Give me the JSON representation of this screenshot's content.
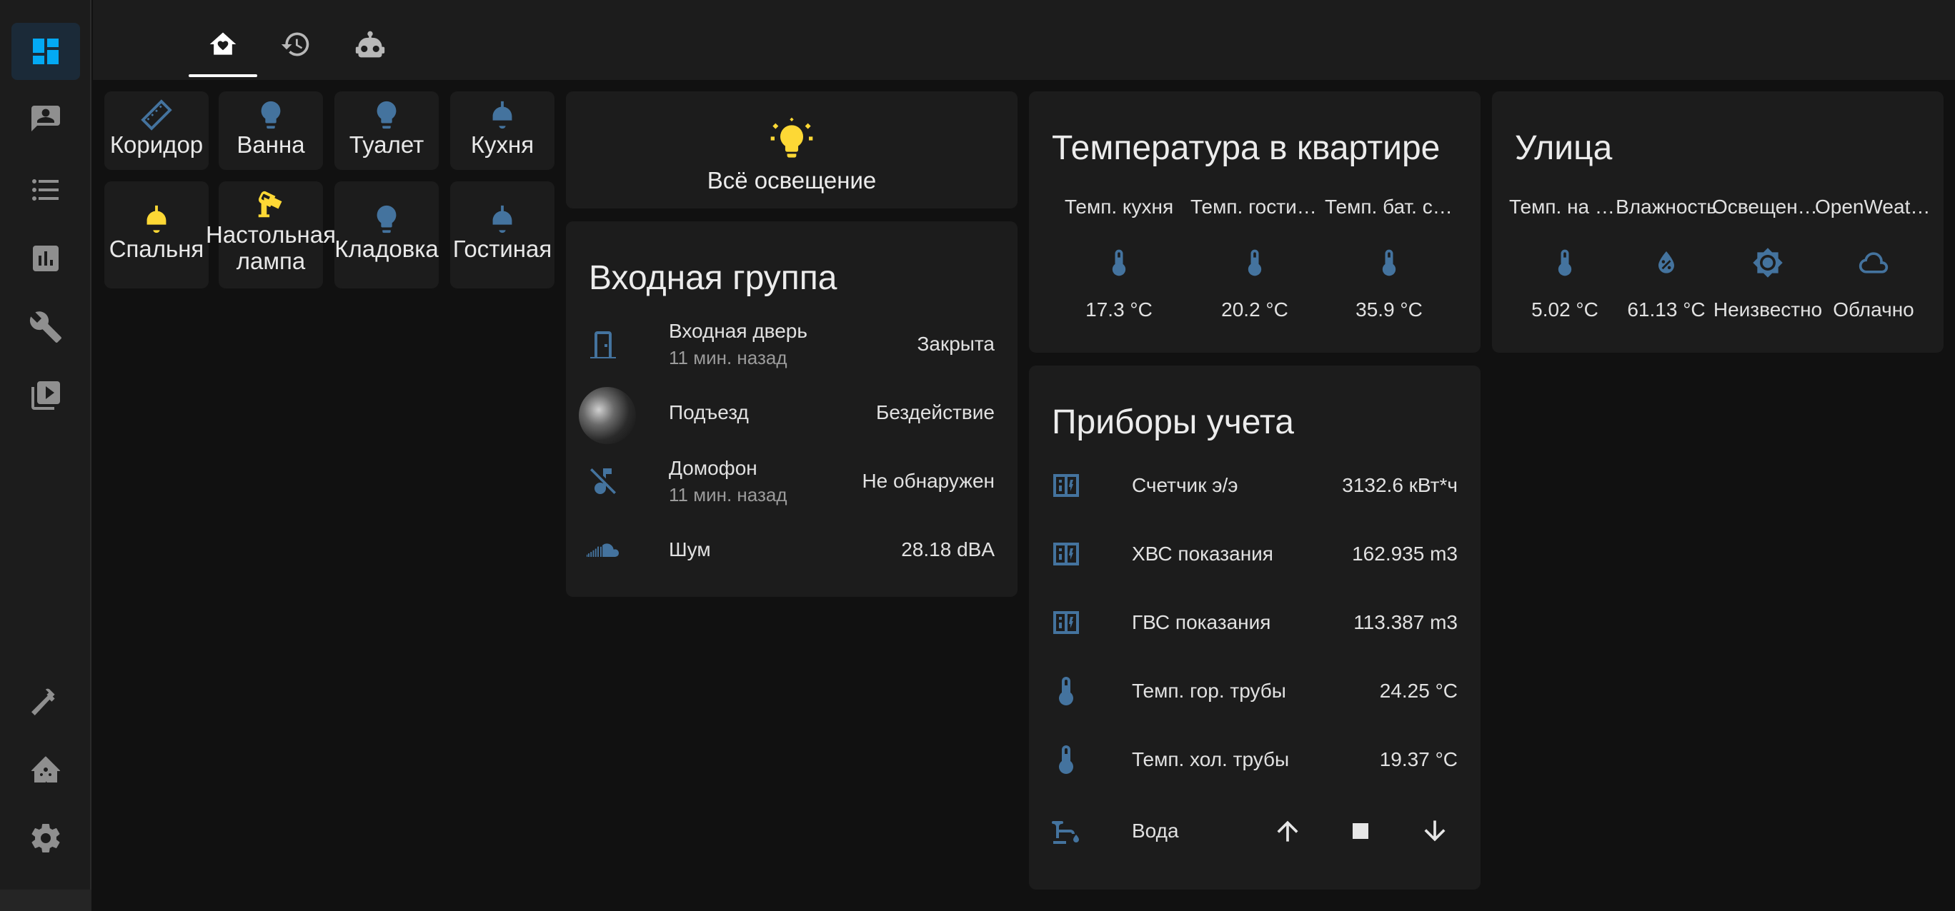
{
  "colors": {
    "accent": "#03a9f4",
    "icon_blue": "#44739e",
    "light_on": "#fdd835"
  },
  "sidebar": {
    "items": [
      {
        "name": "dashboard-icon"
      },
      {
        "name": "map-icon"
      },
      {
        "name": "logbook-icon"
      },
      {
        "name": "history-icon"
      },
      {
        "name": "tools-icon"
      },
      {
        "name": "media-icon"
      },
      {
        "name": "developer-tools-icon"
      },
      {
        "name": "supervisor-icon"
      },
      {
        "name": "settings-icon"
      }
    ]
  },
  "tabs": [
    {
      "name": "home-tab"
    },
    {
      "name": "history-tab"
    },
    {
      "name": "automations-tab"
    }
  ],
  "tiles": [
    {
      "label": "Коридор",
      "icon": "led-strip-icon",
      "state": "off"
    },
    {
      "label": "Ванна",
      "icon": "lightbulb-icon",
      "state": "off"
    },
    {
      "label": "Туалет",
      "icon": "lightbulb-icon",
      "state": "off"
    },
    {
      "label": "Кухня",
      "icon": "ceiling-light-icon",
      "state": "off"
    },
    {
      "label": "Спальня",
      "icon": "ceiling-light-icon",
      "state": "on"
    },
    {
      "label": "Настольная лампа",
      "icon": "desk-lamp-icon",
      "state": "on"
    },
    {
      "label": "Кладовка",
      "icon": "lightbulb-icon",
      "state": "off"
    },
    {
      "label": "Гостиная",
      "icon": "ceiling-light-icon",
      "state": "off"
    }
  ],
  "all_lights": {
    "label": "Всё освещение",
    "icon": "lightbulb-group-icon"
  },
  "entrance": {
    "title": "Входная группа",
    "rows": [
      {
        "name": "Входная дверь",
        "sub": "11 мин. назад",
        "value": "Закрыта"
      },
      {
        "name": "Подъезд",
        "value": "Бездействие"
      },
      {
        "name": "Домофон",
        "sub": "11 мин. назад",
        "value": "Не обнаружен"
      },
      {
        "name": "Шум",
        "value": "28.18 dBA"
      }
    ]
  },
  "temperature": {
    "title": "Температура в квартире",
    "items": [
      {
        "name": "Темп. кухня",
        "value": "17.3 °C"
      },
      {
        "name": "Темп. гостиная",
        "value": "20.2 °C"
      },
      {
        "name": "Темп. бат. спальня",
        "value": "35.9 °C"
      }
    ]
  },
  "street": {
    "title": "Улица",
    "items": [
      {
        "name": "Темп. на улице",
        "value": "5.02 °C"
      },
      {
        "name": "Влажность",
        "value": "61.13 °C"
      },
      {
        "name": "Освещенность",
        "value": "Неизвестно"
      },
      {
        "name": "OpenWeatherMap",
        "value": "Облачно"
      }
    ]
  },
  "meters": {
    "title": "Приборы учета",
    "rows": [
      {
        "name": "Счетчик э/э",
        "value": "3132.6 кВт*ч"
      },
      {
        "name": "ХВС показания",
        "value": "162.935 m3"
      },
      {
        "name": "ГВС показания",
        "value": "113.387 m3"
      },
      {
        "name": "Темп. гор. трубы",
        "value": "24.25 °C"
      },
      {
        "name": "Темп. хол. трубы",
        "value": "19.37 °C"
      },
      {
        "name": "Вода"
      }
    ]
  }
}
